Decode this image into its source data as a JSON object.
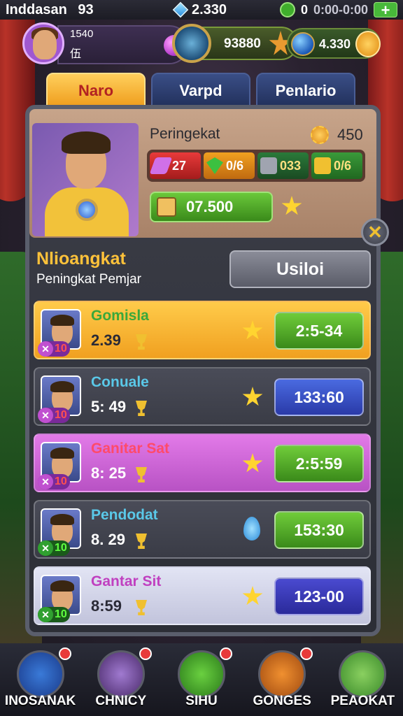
{
  "status_bar": {
    "app_title": "Inddasan",
    "app_badge": "93",
    "gems": "2.330",
    "clover_count": "0",
    "timer": "0:00-0:00",
    "plus_label": "+"
  },
  "profile": {
    "level": "1540",
    "name": "伍",
    "coins": "93880",
    "energy": "4.330"
  },
  "tabs": [
    {
      "label": "Naro",
      "active": true
    },
    {
      "label": "Varpd",
      "active": false
    },
    {
      "label": "Penlario",
      "active": false
    }
  ],
  "hero": {
    "rank_title": "Peringekat",
    "rank_value": "450",
    "stats": [
      {
        "icon": "gem-icon",
        "value": "27"
      },
      {
        "icon": "emerald-icon",
        "value": "0/6"
      },
      {
        "icon": "cube-icon",
        "value": "033"
      },
      {
        "icon": "chest-icon",
        "value": "0/6"
      }
    ],
    "reward_value": "07.500",
    "close_label": "✕"
  },
  "section": {
    "title": "Nlioangkat",
    "subtitle": "Peningkat Pemjar",
    "action_label": "Usiloi"
  },
  "leaderboard": [
    {
      "name": "Gomisla",
      "score": "2.39",
      "level": "10",
      "right_icon": "star",
      "button": "2:5-34",
      "style": "gold",
      "btn": "green"
    },
    {
      "name": "Conuale",
      "score": "5: 49",
      "level": "10",
      "right_icon": "star",
      "button": "133:60",
      "style": "slate",
      "btn": "blue"
    },
    {
      "name": "Ganitar Sat",
      "score": "8: 25",
      "level": "10",
      "right_icon": "star",
      "button": "2:5:59",
      "style": "pink",
      "btn": "green"
    },
    {
      "name": "Pendodat",
      "score": "8. 29",
      "level": "10",
      "right_icon": "drop",
      "button": "153:30",
      "style": "slate",
      "btn": "green"
    },
    {
      "name": "Gantar Sit",
      "score": "8:59",
      "level": "10",
      "right_icon": "star",
      "button": "123-00",
      "style": "lilac",
      "btn": "navy"
    }
  ],
  "bottom_nav": [
    {
      "label": "INOSANAK",
      "icon": "inventory-icon"
    },
    {
      "label": "CHNICY",
      "icon": "heroes-icon"
    },
    {
      "label": "SIHU",
      "icon": "pet-icon"
    },
    {
      "label": "GONGES",
      "icon": "monster-icon"
    },
    {
      "label": "PEAOKAT",
      "icon": "creature-icon"
    }
  ]
}
